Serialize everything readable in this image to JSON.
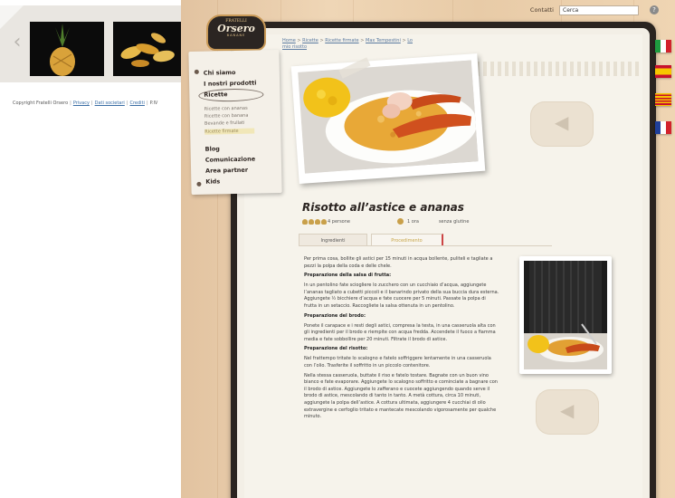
{
  "overlay": {
    "gallery": {
      "prev_icon": "chevron-left-icon"
    },
    "footer": {
      "copyright": "Copyright Fratelli Orsero",
      "links": [
        "Privacy",
        "Dati societari",
        "Crediti",
        "P.IV"
      ]
    }
  },
  "header": {
    "contact_label": "Contatti",
    "search_value": "Cerca",
    "help_icon": "help-icon"
  },
  "logo": {
    "top": "FRATELLI",
    "name": "Orsero",
    "tag": "BANANE"
  },
  "menu": {
    "items": [
      {
        "label": "Chi siamo"
      },
      {
        "label": "I nostri prodotti"
      },
      {
        "label": "Ricette"
      }
    ],
    "sub_items": [
      {
        "label": "Ricette con ananas"
      },
      {
        "label": "Ricette con banana"
      },
      {
        "label": "Bevande e frullati"
      },
      {
        "label": "Ricette firmate"
      }
    ],
    "items_more": [
      {
        "label": "Blog"
      },
      {
        "label": "Comunicazione"
      },
      {
        "label": "Area partner"
      },
      {
        "label": "Kids"
      }
    ]
  },
  "breadcrumb": {
    "items": [
      "Home",
      "Ricette",
      "Ricette firmate",
      "Max Tempestini",
      "Lo"
    ],
    "continuation": "mio risotto",
    "separator": ">"
  },
  "recipe": {
    "title": "Risotto all’astice e ananas",
    "persons": "4 persone",
    "time": "1 ora",
    "gluten": "senza glutine",
    "tabs": [
      "Ingredienti",
      "Procedimento"
    ],
    "active_tab": "Procedimento",
    "paragraphs": [
      {
        "type": "text",
        "value": "Per prima cosa, bollite gli astici per 15 minuti in acqua bollente, puliteli e tagliate a pezzi la polpa della coda e delle chele."
      },
      {
        "type": "heading",
        "value": "Preparazione della salsa di frutta:"
      },
      {
        "type": "text",
        "value": "In un pentolino fate sciogliere lo zucchero con un cucchiaio d’acqua, aggiungete l’ananas tagliato a cubetti piccoli e il banarindo privato della sua buccia dura esterna. Aggiungete ½ bicchiere d’acqua e fate cuocere per 5 minuti. Passate la polpa di frutta in un setaccio. Raccogliete la salsa ottenuta in un pentolino."
      },
      {
        "type": "heading",
        "value": "Preparazione del brodo:"
      },
      {
        "type": "text",
        "value": "Ponete il carapace e i resti degli astici, compresa la testa, in una casseruola alta con gli ingredienti per il brodo e riempite con acqua fredda. Accendete il fuoco a fiamma media e fate sobbollire per 20 minuti. Filtrate il brodo di astice."
      },
      {
        "type": "heading",
        "value": "Preparazione del risotto:"
      },
      {
        "type": "text",
        "value": "Nel frattempo tritate lo scalogno e fatelo soffriggere lentamente in una casseruola con l’olio. Trasferite il soffritto in un piccolo contenitore."
      },
      {
        "type": "text",
        "value": "Nella stessa casseruola, buttate il riso e fatelo tostare. Bagnate con un buon vino bianco e fate evaporare. Aggiungete lo scalogno soffritto e cominciate a bagnare con il brodo di astice. Aggiungete lo zafferano e cuocete aggiungendo quando serve il brodo di astice, mescolando di tanto in tanto. A metà cottura, circa 10 minuti, aggiungete la polpa dell’astice. A cottura ultimata, aggiungere 4 cucchiai di olio extravergine e cerfoglio tritato e mantecate mescolando vigorosamente per qualche minuto."
      }
    ]
  },
  "flags": [
    "Italiano",
    "Español",
    "Català",
    "Français"
  ],
  "colors": {
    "wood": "#efd6b6",
    "notebook": "#2a2420",
    "paper": "#f6f3eb",
    "accent_gold": "#c9a04a",
    "link_blue": "#3a6ea5"
  }
}
